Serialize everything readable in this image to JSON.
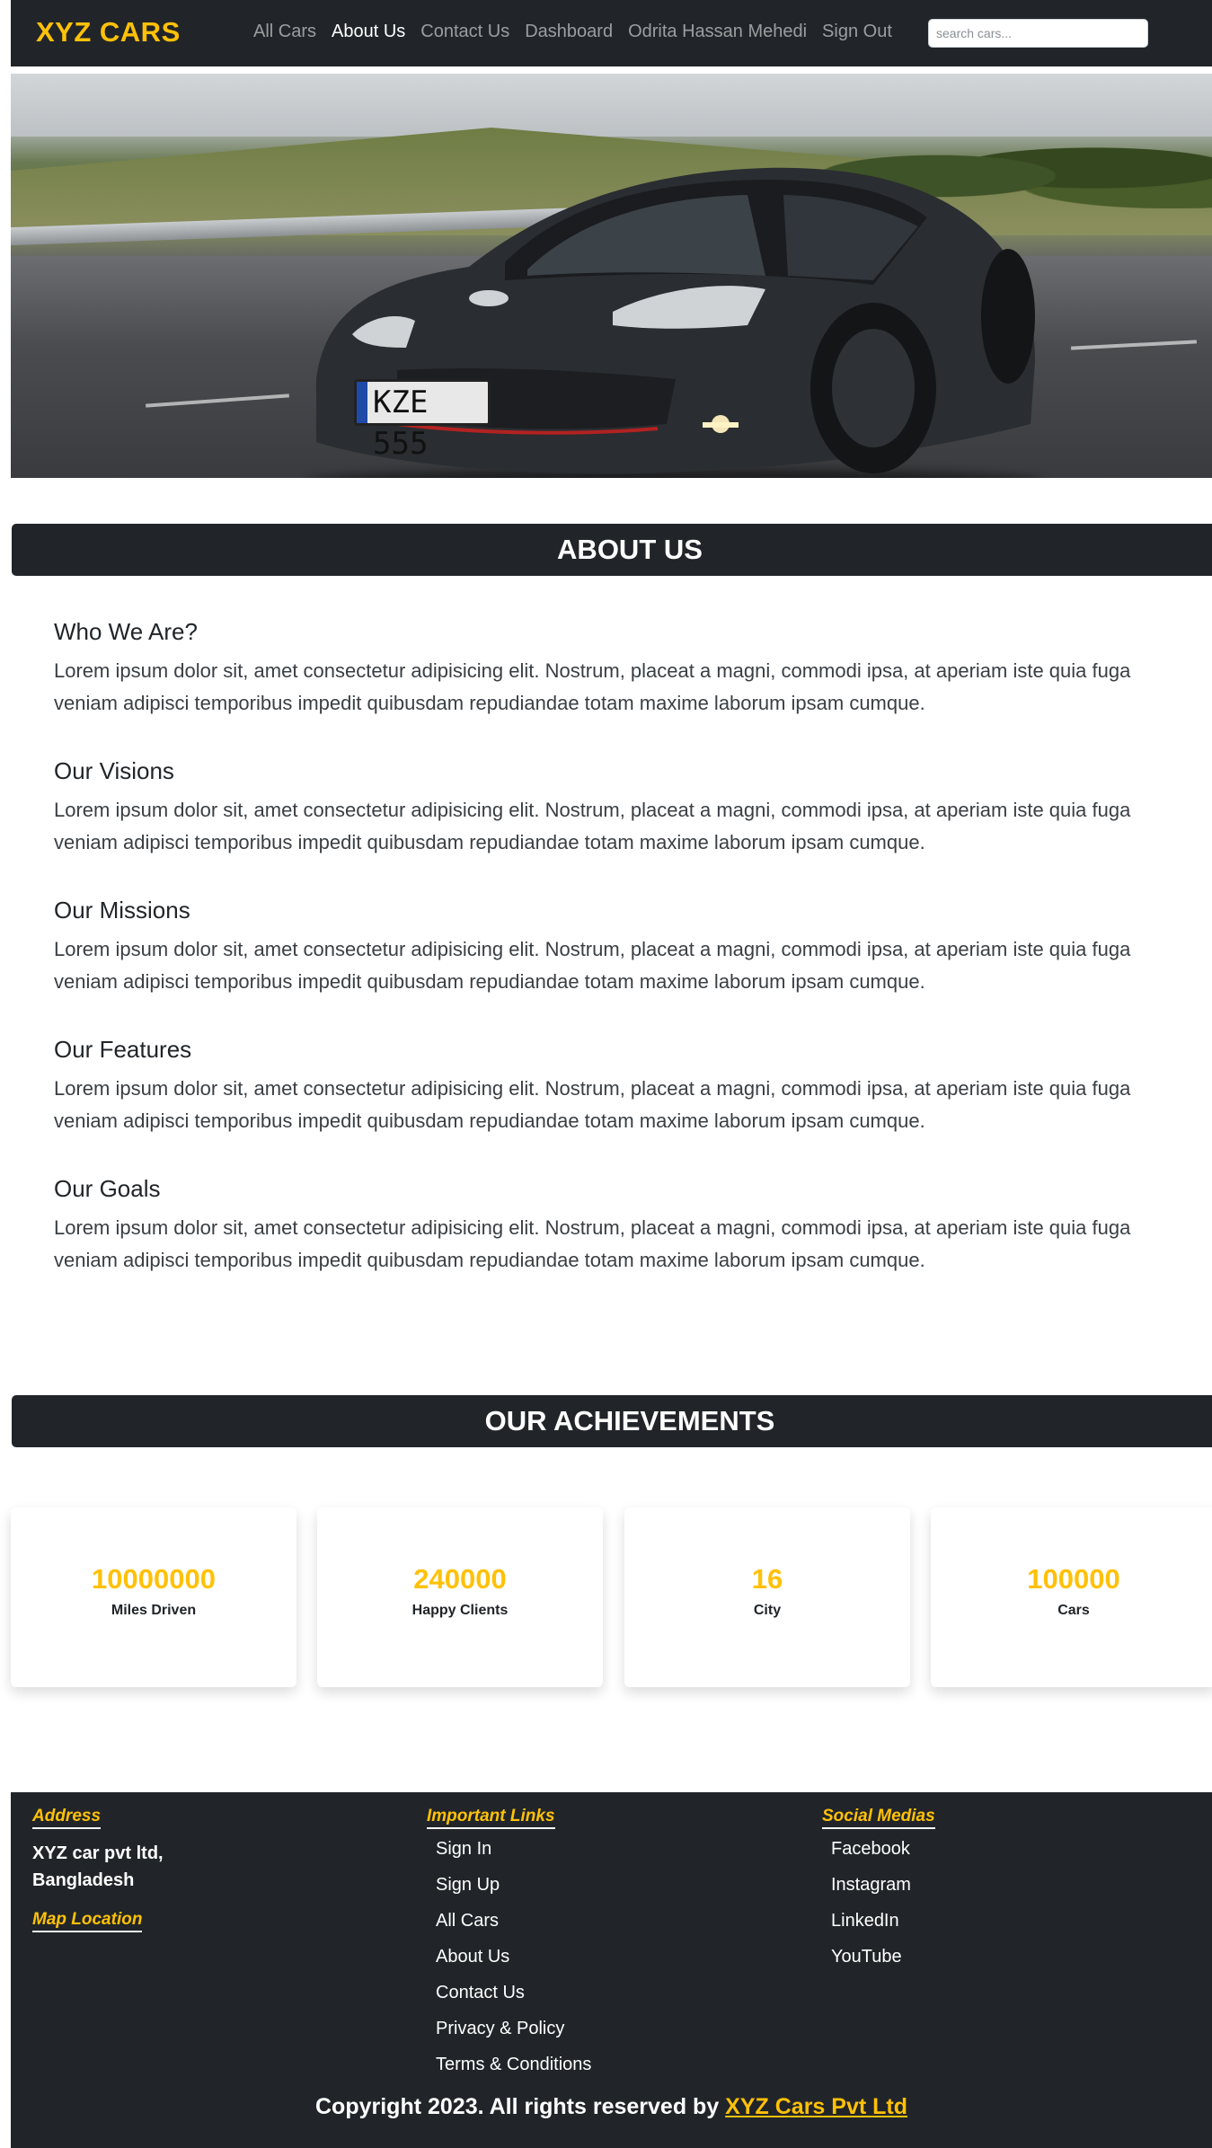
{
  "navbar": {
    "brand": "XYZ CARS",
    "links": [
      {
        "label": "All Cars"
      },
      {
        "label": "About Us"
      },
      {
        "label": "Contact Us"
      },
      {
        "label": "Dashboard"
      },
      {
        "label": "Odrita Hassan Mehedi"
      },
      {
        "label": "Sign Out"
      }
    ],
    "active_link": "About Us",
    "search": {
      "placeholder": "search cars...",
      "value": ""
    }
  },
  "hero": {
    "plate_text": "KZE 555"
  },
  "about": {
    "heading": "ABOUT US",
    "items": [
      {
        "title": "Who We Are?",
        "text": "Lorem ipsum dolor sit, amet consectetur adipisicing elit. Nostrum, placeat a magni, commodi ipsa, at aperiam iste quia fuga veniam adipisci temporibus impedit quibusdam repudiandae totam maxime laborum ipsam cumque."
      },
      {
        "title": "Our Visions",
        "text": "Lorem ipsum dolor sit, amet consectetur adipisicing elit. Nostrum, placeat a magni, commodi ipsa, at aperiam iste quia fuga veniam adipisci temporibus impedit quibusdam repudiandae totam maxime laborum ipsam cumque."
      },
      {
        "title": "Our Missions",
        "text": "Lorem ipsum dolor sit, amet consectetur adipisicing elit. Nostrum, placeat a magni, commodi ipsa, at aperiam iste quia fuga veniam adipisci temporibus impedit quibusdam repudiandae totam maxime laborum ipsam cumque."
      },
      {
        "title": "Our Features",
        "text": "Lorem ipsum dolor sit, amet consectetur adipisicing elit. Nostrum, placeat a magni, commodi ipsa, at aperiam iste quia fuga veniam adipisci temporibus impedit quibusdam repudiandae totam maxime laborum ipsam cumque."
      },
      {
        "title": "Our Goals",
        "text": "Lorem ipsum dolor sit, amet consectetur adipisicing elit. Nostrum, placeat a magni, commodi ipsa, at aperiam iste quia fuga veniam adipisci temporibus impedit quibusdam repudiandae totam maxime laborum ipsam cumque."
      }
    ]
  },
  "achievements": {
    "heading": "OUR ACHIEVEMENTS",
    "stats": [
      {
        "value": "10000000",
        "label": "Miles Driven"
      },
      {
        "value": "240000",
        "label": "Happy Clients"
      },
      {
        "value": "16",
        "label": "City"
      },
      {
        "value": "100000",
        "label": "Cars"
      }
    ]
  },
  "footer": {
    "address": {
      "heading": "Address",
      "line1": "XYZ car pvt ltd,",
      "line2": "Bangladesh",
      "map_heading": "Map Location"
    },
    "important_links": {
      "heading": "Important Links",
      "items": [
        "Sign In",
        "Sign Up",
        "All Cars",
        "About Us",
        "Contact Us",
        "Privacy & Policy",
        "Terms & Conditions"
      ]
    },
    "social": {
      "heading": "Social Medias",
      "items": [
        "Facebook",
        "Instagram",
        "LinkedIn",
        "YouTube"
      ]
    },
    "copyright_text": "Copyright 2023. All rights reserved by ",
    "copyright_link": "XYZ Cars Pvt Ltd"
  },
  "colors": {
    "brand": "#ffc107",
    "dark": "#212529"
  }
}
